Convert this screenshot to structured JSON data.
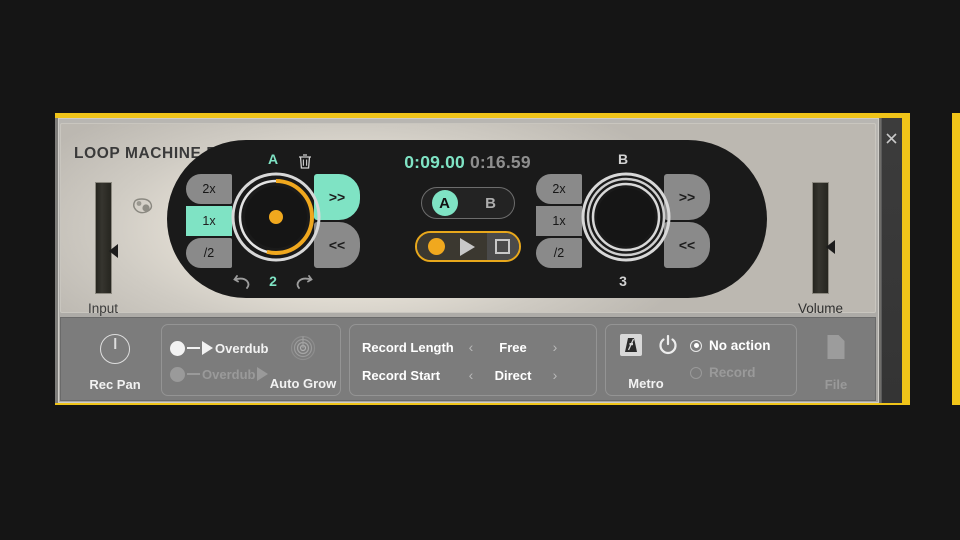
{
  "window": {
    "title": "LOOP MACHINE PRO",
    "close_icon": "close-icon",
    "accent_frame_color": "#f0c419"
  },
  "faders": {
    "input": {
      "label": "Input",
      "position_pct": 45
    },
    "volume": {
      "label": "Volume",
      "position_pct": 48
    }
  },
  "transport_display": {
    "current_time": "0:09.00",
    "total_time": "0:16.59",
    "current_time_color": "#7fe3c4",
    "total_time_color": "#8e8e8e"
  },
  "ab_toggle": {
    "options": [
      "A",
      "B"
    ],
    "selected": "A",
    "selected_color": "#7fe3c4"
  },
  "transport_buttons": {
    "record_label": "record",
    "play_label": "play",
    "stop_label": "stop",
    "accent_color": "#e8a81c"
  },
  "wheels": [
    {
      "id": "a",
      "label": "A",
      "label_color": "#7fe3c4",
      "active": true,
      "ratios": [
        "2x",
        "1x",
        "/2"
      ],
      "ratio_selected": "1x",
      "nav": [
        ">>",
        "<<"
      ],
      "nav_selected": ">>",
      "loop_count": "2",
      "progress_pct": 54,
      "progress_color": "#f0a81e",
      "trash_icon": "trash-icon",
      "undo_icon": "undo-icon",
      "redo_icon": "redo-icon"
    },
    {
      "id": "b",
      "label": "B",
      "label_color": "#d2d2d2",
      "active": false,
      "ratios": [
        "2x",
        "1x",
        "/2"
      ],
      "ratio_selected": "",
      "nav": [
        ">>",
        "<<"
      ],
      "nav_selected": "",
      "loop_count": "3",
      "progress_pct": 0,
      "progress_color": "#d2d2d2",
      "trash_icon": "",
      "undo_icon": "",
      "redo_icon": ""
    }
  ],
  "bottom_bar": {
    "rec_pan": {
      "label": "Rec Pan",
      "knob_value": 0
    },
    "overdub": {
      "row1_label": "Overdub",
      "row2_label": "Overdub",
      "row1_enabled": true,
      "row2_enabled": false
    },
    "auto_grow": {
      "label": "Auto Grow",
      "icon": "target-icon"
    },
    "record_settings": [
      {
        "label": "Record Length",
        "value": "Free",
        "prev": "‹",
        "next": "›"
      },
      {
        "label": "Record Start",
        "value": "Direct",
        "prev": "‹",
        "next": "›"
      }
    ],
    "metro": {
      "label": "Metro",
      "metronome_icon": "metronome-icon",
      "power_icon": "power-icon",
      "options": [
        {
          "label": "No action",
          "selected": true
        },
        {
          "label": "Record",
          "selected": false
        }
      ]
    },
    "file": {
      "label": "File",
      "icon": "file-icon",
      "enabled": false
    }
  }
}
